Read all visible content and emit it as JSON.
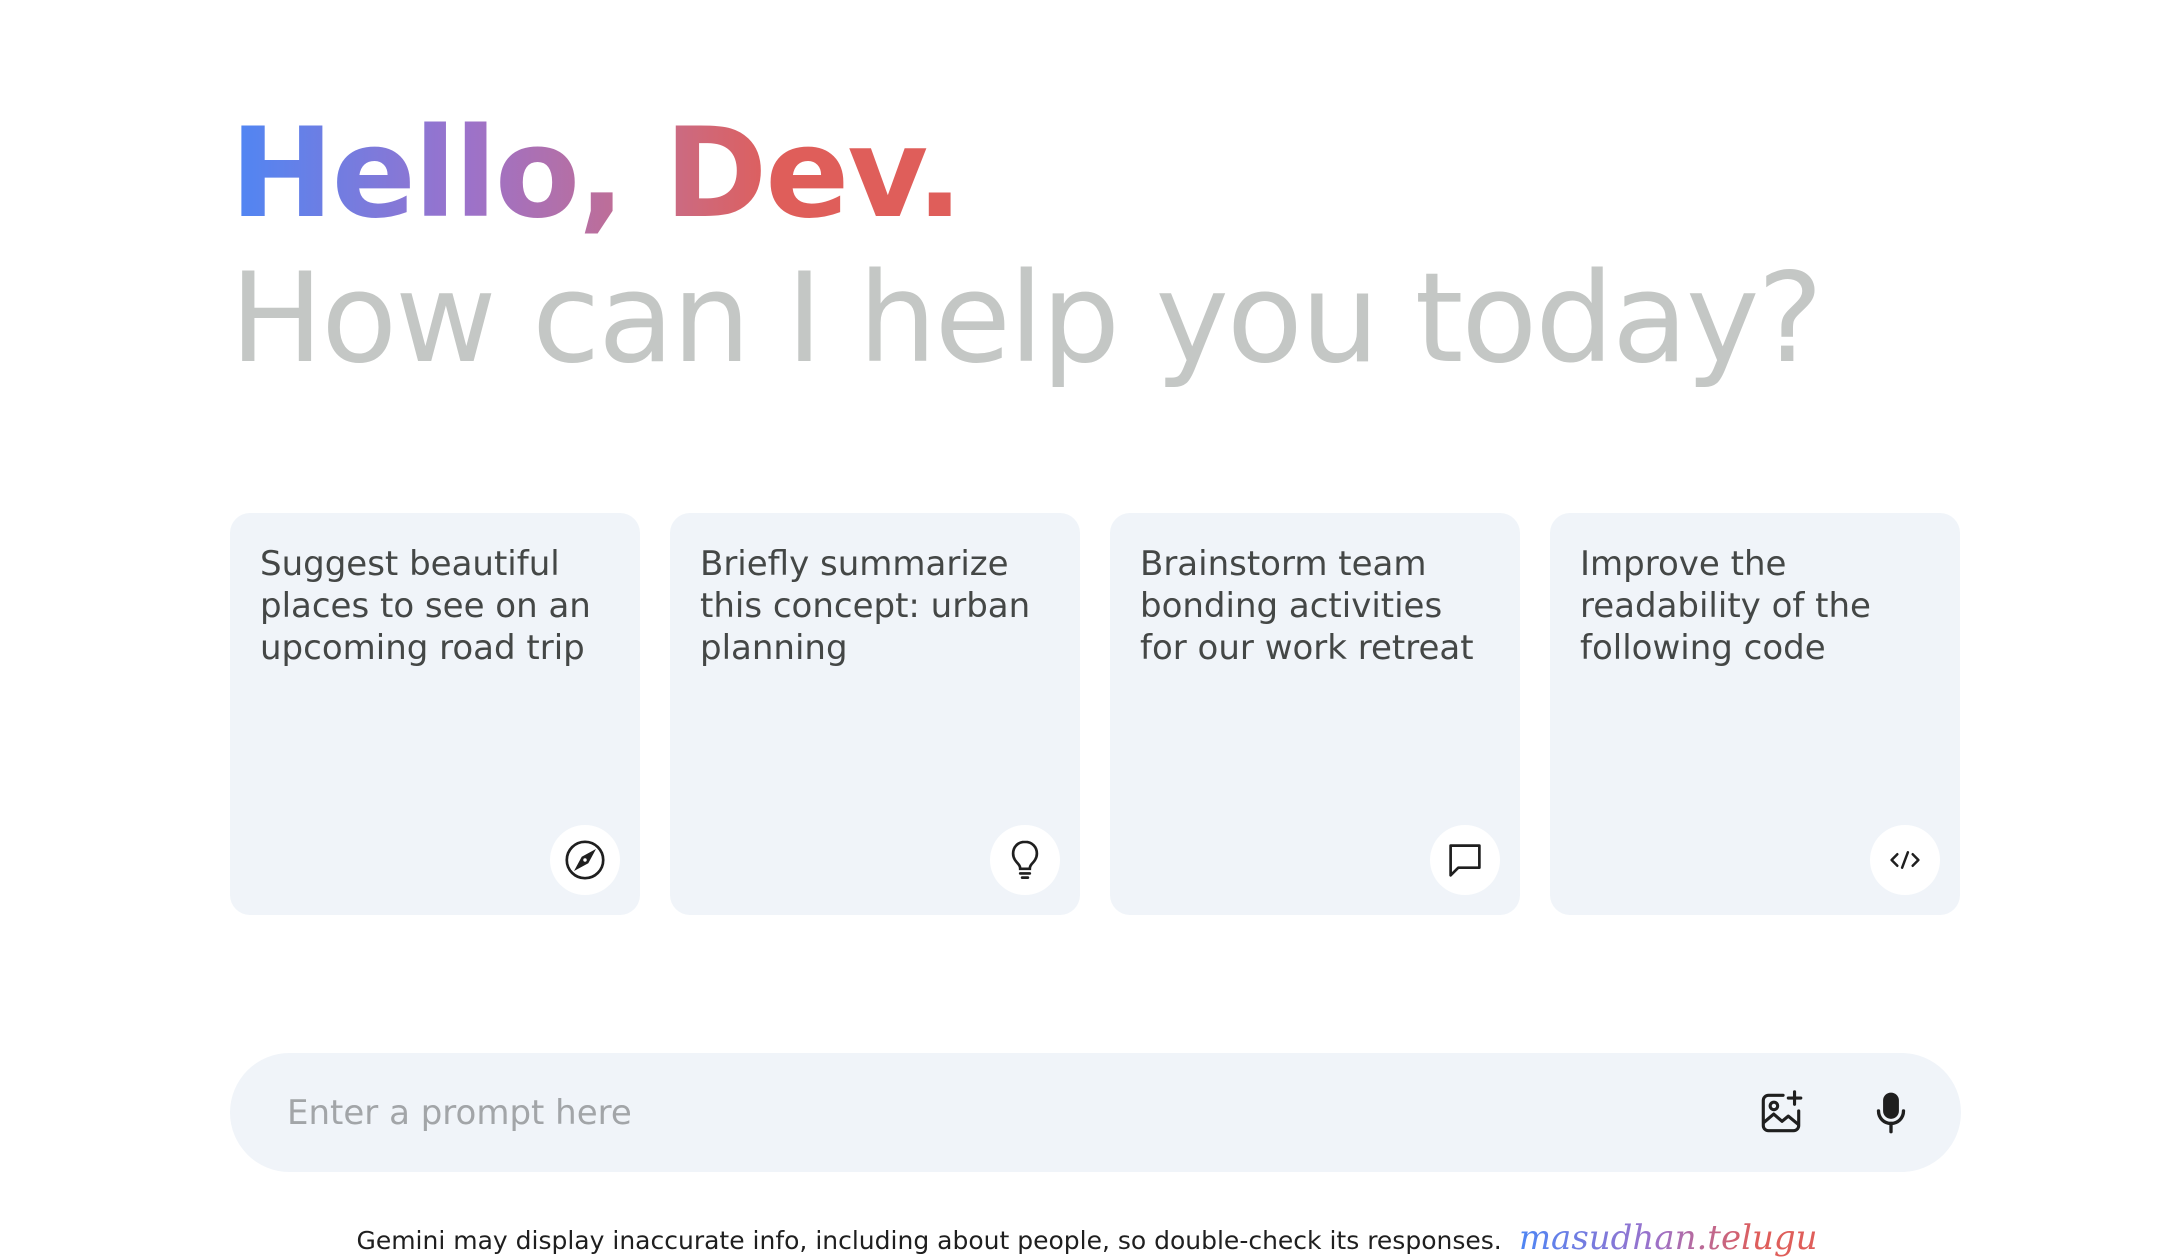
{
  "greeting": {
    "title": "Hello, Dev.",
    "subtitle": "How can I help you today?"
  },
  "cards": [
    {
      "text": "Suggest beautiful places to see on an upcoming road trip",
      "icon": "compass-icon"
    },
    {
      "text": "Briefly summarize this concept: urban planning",
      "icon": "lightbulb-icon"
    },
    {
      "text": "Brainstorm team bonding activities for our work retreat",
      "icon": "message-icon"
    },
    {
      "text": "Improve the readability of the following code",
      "icon": "code-icon"
    }
  ],
  "prompt": {
    "placeholder": "Enter a prompt here",
    "value": "",
    "actions": [
      {
        "icon": "add-image-icon"
      },
      {
        "icon": "microphone-icon"
      }
    ]
  },
  "footer": {
    "disclaimer": "Gemini may display inaccurate info, including about people, so double-check its responses.",
    "watermark": "masudhan.telugu"
  },
  "colors": {
    "gradient_start": "#4e86f4",
    "gradient_mid": "#9b72cb",
    "gradient_end": "#df5e5a",
    "subtitle": "#c4c7c5",
    "card_background": "#f0f4f9",
    "text": "#444746"
  }
}
